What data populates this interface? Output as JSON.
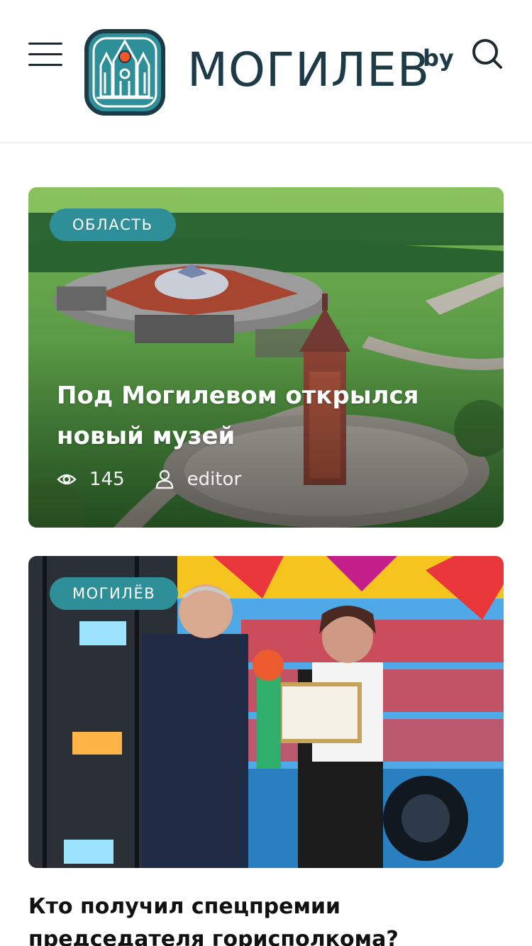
{
  "header": {
    "logo_text": "МОГИЛЕВ",
    "logo_suffix": "by",
    "menu_icon": "hamburger-menu-icon",
    "search_icon": "search-icon"
  },
  "colors": {
    "brand_dark": "#1d3a47",
    "accent_teal": "#2f8f98",
    "logo_orange": "#f0562c"
  },
  "articles": [
    {
      "category": "ОБЛАСТЬ",
      "title": "Под Могилевом открылся новый музей",
      "views": "145",
      "author": "editor",
      "image": "aerial-museum-photo"
    },
    {
      "category": "МОГИЛЁВ",
      "title": "Кто получил спецпремии председателя горисполкома?",
      "image": "award-ceremony-photo"
    }
  ]
}
